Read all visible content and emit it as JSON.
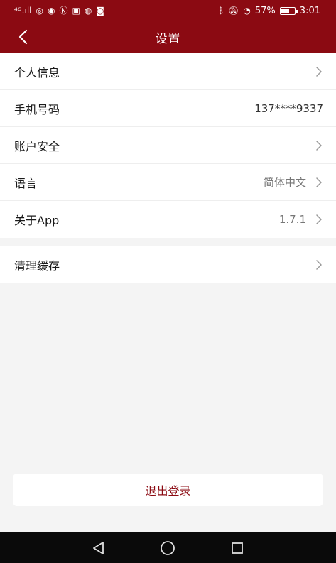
{
  "status_bar": {
    "left_text": "⁴ᴳ.ıll",
    "battery_percent": "57%",
    "battery_level": 0.57,
    "time": "3:01"
  },
  "header": {
    "title": "设置",
    "back_icon": "chevron-left-icon"
  },
  "settings": {
    "group1": [
      {
        "label": "个人信息",
        "value": "",
        "chevron": true
      },
      {
        "label": "手机号码",
        "value": "137****9337",
        "chevron": false
      },
      {
        "label": "账户安全",
        "value": "",
        "chevron": true
      },
      {
        "label": "语言",
        "value": "简体中文",
        "chevron": true
      },
      {
        "label": "关于App",
        "value": "1.7.1",
        "chevron": true
      }
    ],
    "group2": [
      {
        "label": "清理缓存",
        "value": "",
        "chevron": true
      }
    ]
  },
  "logout": {
    "label": "退出登录"
  },
  "colors": {
    "brand": "#8b0a12",
    "background": "#f4f4f4"
  }
}
